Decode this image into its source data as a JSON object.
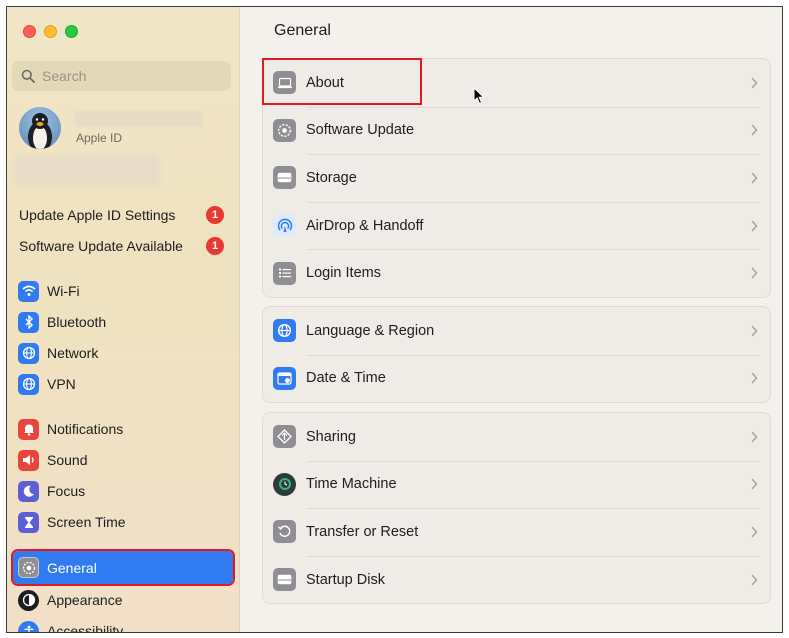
{
  "window": {
    "page_title": "General"
  },
  "sidebar": {
    "search_placeholder": "Search",
    "apple_id_label": "Apple ID",
    "notices": [
      {
        "label": "Update Apple ID Settings",
        "badge": "1"
      },
      {
        "label": "Software Update Available",
        "badge": "1"
      }
    ],
    "items": [
      {
        "label": "Wi-Fi",
        "icon": "wifi-icon",
        "color": "#2f7bef"
      },
      {
        "label": "Bluetooth",
        "icon": "bluetooth-icon",
        "color": "#2f7bef"
      },
      {
        "label": "Network",
        "icon": "globe-icon",
        "color": "#2f7bef"
      },
      {
        "label": "VPN",
        "icon": "globe-icon",
        "color": "#2f7bef"
      },
      {
        "label": "Notifications",
        "icon": "bell-icon",
        "color": "#e8453c"
      },
      {
        "label": "Sound",
        "icon": "speaker-icon",
        "color": "#e8453c"
      },
      {
        "label": "Focus",
        "icon": "moon-icon",
        "color": "#5b5fd6"
      },
      {
        "label": "Screen Time",
        "icon": "hourglass-icon",
        "color": "#5b5fd6"
      },
      {
        "label": "General",
        "icon": "gear-icon",
        "color": "#8e8e93",
        "selected": true
      },
      {
        "label": "Appearance",
        "icon": "appearance-icon",
        "color": "#1d1d1f"
      },
      {
        "label": "Accessibility",
        "icon": "accessibility-icon",
        "color": "#2f7bef"
      }
    ]
  },
  "main": {
    "groups": [
      [
        {
          "label": "About",
          "icon": "laptop-icon"
        },
        {
          "label": "Software Update",
          "icon": "gear-icon"
        },
        {
          "label": "Storage",
          "icon": "drive-icon"
        },
        {
          "label": "AirDrop & Handoff",
          "icon": "airdrop-icon"
        },
        {
          "label": "Login Items",
          "icon": "list-icon"
        }
      ],
      [
        {
          "label": "Language & Region",
          "icon": "globe-icon"
        },
        {
          "label": "Date & Time",
          "icon": "calendar-icon"
        }
      ],
      [
        {
          "label": "Sharing",
          "icon": "sharing-icon"
        },
        {
          "label": "Time Machine",
          "icon": "time-machine-icon"
        },
        {
          "label": "Transfer or Reset",
          "icon": "reset-icon"
        },
        {
          "label": "Startup Disk",
          "icon": "drive-icon"
        }
      ]
    ]
  },
  "colors": {
    "accent": "#2f7bef",
    "highlight_outline": "#e21b23",
    "badge": "#e8382f"
  }
}
